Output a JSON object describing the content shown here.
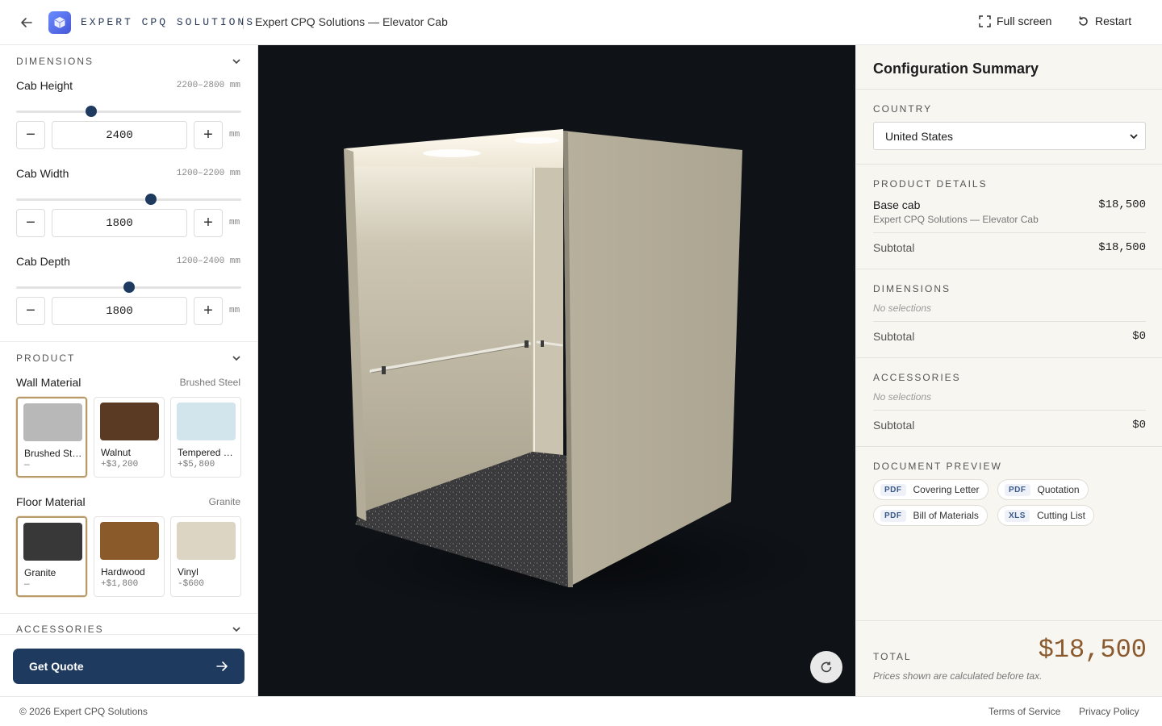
{
  "header": {
    "brand": "EXPERT CPQ SOLUTIONS",
    "title": "Expert CPQ Solutions — Elevator Cab",
    "fullscreen_label": "Full screen",
    "restart_label": "Restart"
  },
  "left": {
    "dimensions": {
      "title": "DIMENSIONS",
      "height": {
        "label": "Cab Height",
        "range": "2200–2800 mm",
        "value": "2400",
        "unit": "mm",
        "fraction": 0.333
      },
      "width": {
        "label": "Cab Width",
        "range": "1200–2200 mm",
        "value": "1800",
        "unit": "mm",
        "fraction": 0.6
      },
      "depth": {
        "label": "Cab Depth",
        "range": "1200–2400 mm",
        "value": "1800",
        "unit": "mm",
        "fraction": 0.5
      }
    },
    "product": {
      "title": "PRODUCT",
      "wall": {
        "label": "Wall Material",
        "current": "Brushed Steel",
        "options": [
          {
            "name": "Brushed Steel",
            "price": "—",
            "color": "#b8b8b8"
          },
          {
            "name": "Walnut",
            "price": "+$3,200",
            "color": "#5a3a22"
          },
          {
            "name": "Tempered Glass",
            "price": "+$5,800",
            "color": "#d2e4ec"
          }
        ]
      },
      "floor": {
        "label": "Floor Material",
        "current": "Granite",
        "options": [
          {
            "name": "Granite",
            "price": "—",
            "color": "#383838"
          },
          {
            "name": "Hardwood",
            "price": "+$1,800",
            "color": "#8b5a2b"
          },
          {
            "name": "Vinyl",
            "price": "-$600",
            "color": "#dcd5c3"
          }
        ]
      }
    },
    "accessories_title": "ACCESSORIES",
    "quote_label": "Get Quote"
  },
  "summary": {
    "title": "Configuration Summary",
    "country_label": "COUNTRY",
    "country_value": "United States",
    "product_details_label": "PRODUCT DETAILS",
    "base_name": "Base cab",
    "base_sub": "Expert CPQ Solutions — Elevator Cab",
    "base_amount": "$18,500",
    "subtotal_label": "Subtotal",
    "product_subtotal": "$18,500",
    "dimensions_label": "DIMENSIONS",
    "no_selections": "No selections",
    "dimensions_subtotal": "$0",
    "accessories_label": "ACCESSORIES",
    "accessories_subtotal": "$0",
    "doc_label": "DOCUMENT PREVIEW",
    "docs": [
      {
        "type": "PDF",
        "name": "Covering Letter"
      },
      {
        "type": "PDF",
        "name": "Quotation"
      },
      {
        "type": "PDF",
        "name": "Bill of Materials"
      },
      {
        "type": "XLS",
        "name": "Cutting List"
      }
    ],
    "total_label": "TOTAL",
    "total_amount": "$18,500",
    "tax_note": "Prices shown are calculated before tax."
  },
  "footer": {
    "copyright": "© 2026 Expert CPQ Solutions",
    "terms": "Terms of Service",
    "privacy": "Privacy Policy"
  },
  "colors": {
    "primary": "#1f3a5f",
    "accent_total": "#8a5a2e",
    "selected_border": "#b89a6a"
  }
}
